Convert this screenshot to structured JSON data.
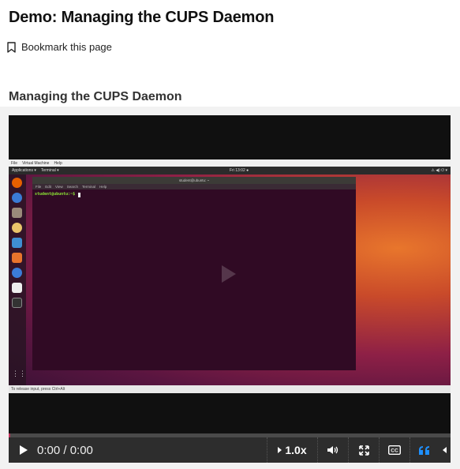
{
  "page": {
    "title": "Demo: Managing the CUPS Daemon",
    "bookmark_label": "Bookmark this page",
    "section_title": "Managing the CUPS Daemon"
  },
  "vm": {
    "menubar_items": [
      "File",
      "Virtual Machine",
      "Help"
    ],
    "topbar_apps": "Applications ▾",
    "topbar_terminal": "Terminal ▾",
    "topbar_clock": "Fri 13:02 ●",
    "topbar_tray": "⚠ ◀) ⏻ ▾",
    "terminal_title": "student@ubuntu: ~",
    "terminal_menu": [
      "File",
      "Edit",
      "View",
      "Search",
      "Terminal",
      "Help"
    ],
    "prompt": "student@ubuntu:~$",
    "status_text": "To release input, press Ctrl+Alt"
  },
  "player": {
    "time": "0:00 / 0:00",
    "speed": "1.0x",
    "progress_fraction": 0.0
  },
  "colors": {
    "accent_progress": "#c0305a",
    "transcript_icon": "#1e90ff",
    "controls_bg": "#2d2d2d"
  }
}
